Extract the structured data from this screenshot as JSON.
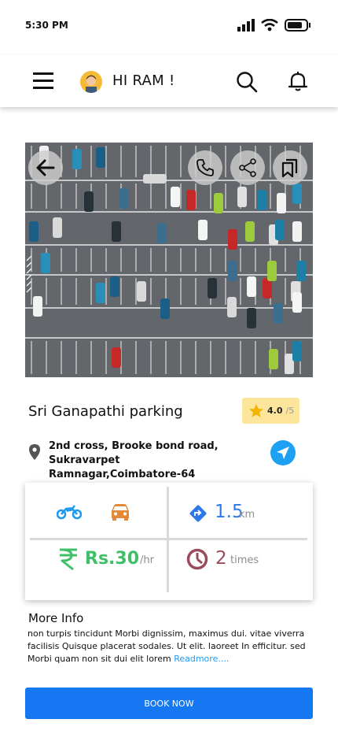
{
  "status": {
    "time": "5:30 PM"
  },
  "header": {
    "greeting": "HI RAM !"
  },
  "parking": {
    "name": "Sri Ganapathi parking",
    "rating": "4.0",
    "rating_max": "/5",
    "address_line1": "2nd cross, Brooke bond road, Sukravarpet",
    "address_line2": "Ramnagar,Coimbatore-64"
  },
  "stats": {
    "distance": "1.5",
    "distance_unit": "km",
    "price": "Rs.30",
    "price_unit": "/hr",
    "visits": "2",
    "visits_unit": "times"
  },
  "more": {
    "title": "More Info",
    "text": "non turpis tincidunt Morbi dignissim, maximus dui. vitae viverra facilisis Quisque placerat sodales. Ut elit. laoreet In efficitur. sed Morbi quam non sit dui elit lorem ",
    "readmore": "Readmore...."
  },
  "actions": {
    "book_label": "BOOK NOW"
  },
  "colors": {
    "primary": "#1577f2",
    "bike": "#1e9bf0",
    "car": "#e4883a",
    "distance": "#2d79ea",
    "price": "#3fbf68",
    "visits": "#9a4c5c",
    "rating_bg": "#fde59b"
  },
  "icons": [
    "signal-icon",
    "wifi-icon",
    "battery-icon",
    "menu-icon",
    "search-icon",
    "bell-icon",
    "back-arrow-icon",
    "phone-icon",
    "share-icon",
    "bookmark-icon",
    "star-icon",
    "location-pin-icon",
    "navigate-icon",
    "bike-icon",
    "car-icon",
    "direction-icon",
    "rupee-icon",
    "clock-icon"
  ]
}
